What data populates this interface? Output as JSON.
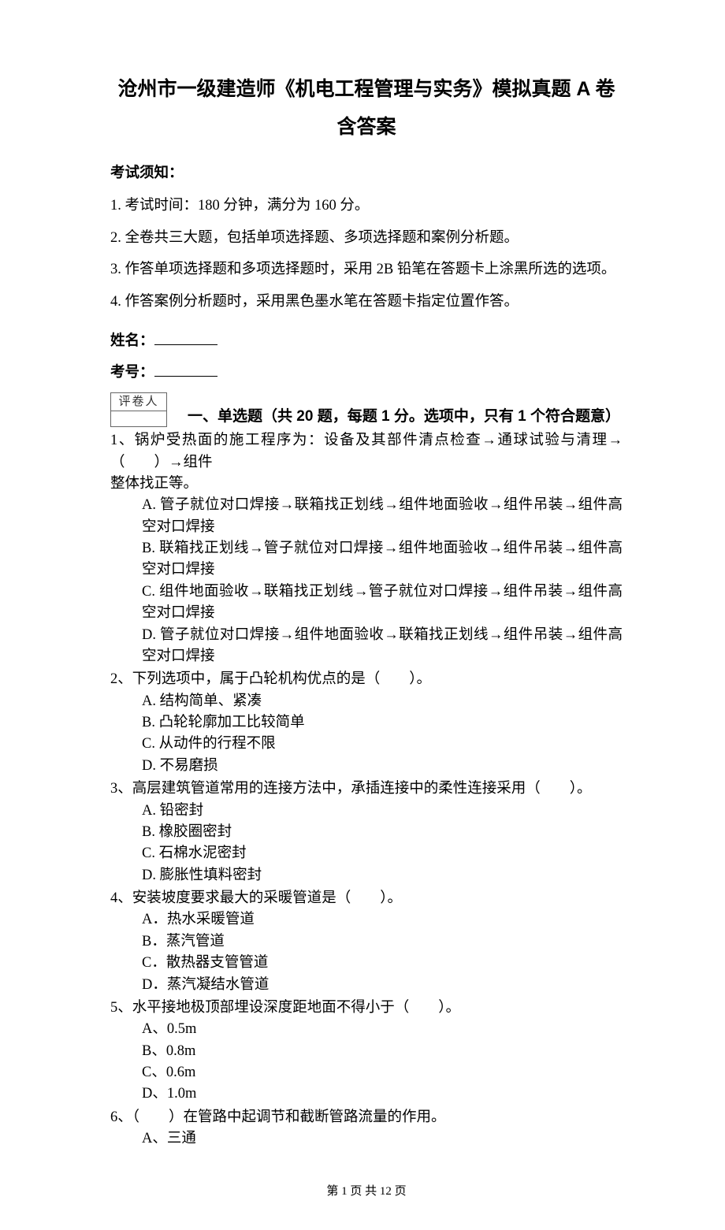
{
  "title_line1": "沧州市一级建造师《机电工程管理与实务》模拟真题 A 卷",
  "title_line2": "含答案",
  "notice_heading": "考试须知：",
  "notice_items": [
    "1. 考试时间：180 分钟，满分为 160 分。",
    "2. 全卷共三大题，包括单项选择题、多项选择题和案例分析题。",
    "3. 作答单项选择题和多项选择题时，采用 2B 铅笔在答题卡上涂黑所选的选项。",
    "4. 作答案例分析题时，采用黑色墨水笔在答题卡指定位置作答。"
  ],
  "name_label": "姓名：",
  "exam_no_label": "考号：",
  "grader_label": "评卷人",
  "section1_heading": "一、单选题（共 20 题，每题 1 分。选项中，只有 1 个符合题意）",
  "questions": [
    {
      "stem_lines": [
        "1、锅炉受热面的施工程序为：设备及其部件清点检查→通球试验与清理→（　　）→组件",
        "整体找正等。"
      ],
      "options": [
        "A. 管子就位对口焊接→联箱找正划线→组件地面验收→组件吊装→组件高空对口焊接",
        "B. 联箱找正划线→管子就位对口焊接→组件地面验收→组件吊装→组件高空对口焊接",
        "C. 组件地面验收→联箱找正划线→管子就位对口焊接→组件吊装→组件高空对口焊接",
        "D. 管子就位对口焊接→组件地面验收→联箱找正划线→组件吊装→组件高空对口焊接"
      ]
    },
    {
      "stem_lines": [
        "2、下列选项中，属于凸轮机构优点的是（　　）。"
      ],
      "options": [
        "A. 结构简单、紧凑",
        "B. 凸轮轮廓加工比较简单",
        "C. 从动件的行程不限",
        "D. 不易磨损"
      ]
    },
    {
      "stem_lines": [
        "3、高层建筑管道常用的连接方法中，承插连接中的柔性连接采用（　　）。"
      ],
      "options": [
        "A. 铅密封",
        "B. 橡胶圈密封",
        "C. 石棉水泥密封",
        "D. 膨胀性填料密封"
      ]
    },
    {
      "stem_lines": [
        "4、安装坡度要求最大的采暖管道是（　　）。"
      ],
      "options": [
        "A．热水采暖管道",
        "B．蒸汽管道",
        "C．散热器支管管道",
        "D．蒸汽凝结水管道"
      ]
    },
    {
      "stem_lines": [
        "5、水平接地极顶部埋设深度距地面不得小于（　　）。"
      ],
      "options": [
        "A、0.5m",
        "B、0.8m",
        "C、0.6m",
        "D、1.0m"
      ]
    },
    {
      "stem_lines": [
        "6、（　　）在管路中起调节和截断管路流量的作用。"
      ],
      "options": [
        "A、三通"
      ]
    }
  ],
  "footer": "第 1 页 共 12 页"
}
